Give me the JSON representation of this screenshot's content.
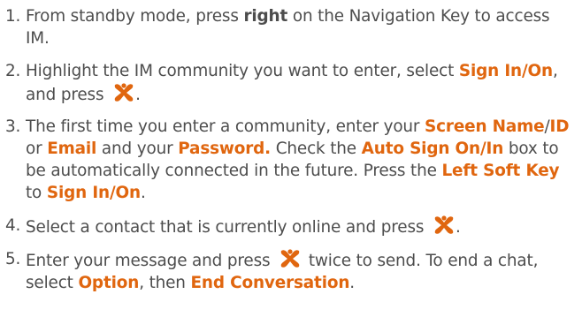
{
  "colors": {
    "text": "#4d4d4d",
    "accent": "#e0660f"
  },
  "icons": {
    "ok_key": "ok-key-icon"
  },
  "steps": [
    {
      "num": "1.",
      "t1": "From standby mode, press ",
      "b1": "right",
      "t2": " on the Navigation Key to access IM."
    },
    {
      "num": "2.",
      "t1": "Highlight the IM community you want to enter, select ",
      "b1": "Sign In/On",
      "t2": ", and press ",
      "t3": "."
    },
    {
      "num": "3.",
      "t1": "The first time you enter a community, enter your ",
      "b1": "Screen Name",
      "t2": "/",
      "b2": "ID",
      "t3": " or ",
      "b3": "Email",
      "t4": " and your ",
      "b4": "Password.",
      "t5": " Check the ",
      "b5": "Auto Sign On/In",
      "t6": " box to be automatically connected in the future. Press the ",
      "b6": "Left Soft Key",
      "t7": " to ",
      "b7": "Sign In/On",
      "t8": "."
    },
    {
      "num": "4.",
      "t1": "Select a contact that is currently online and press ",
      "t2": "."
    },
    {
      "num": "5.",
      "t1": "Enter your message and press ",
      "t2": " twice to send. To end a chat, select ",
      "b1": "Option",
      "t3": ", then ",
      "b2": "End Conversation",
      "t4": "."
    }
  ]
}
